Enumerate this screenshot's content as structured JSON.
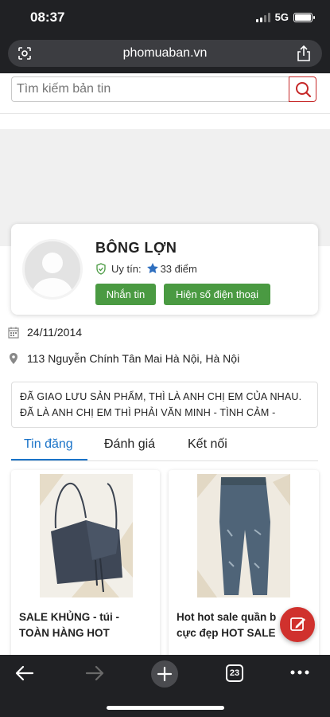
{
  "status": {
    "time": "08:37",
    "network": "5G"
  },
  "browser": {
    "url": "phomuaban.vn",
    "tab_count": "23"
  },
  "search": {
    "placeholder": "Tìm kiếm bản tin"
  },
  "profile": {
    "name": "BÔNG LỢN",
    "trust_label": "Uy tín:",
    "trust_points": "33 điểm",
    "message_button": "Nhắn tin",
    "phone_button": "Hiện số điện thoại",
    "join_date": "24/11/2014",
    "address": "113 Nguyễn Chính Tân Mai Hà Nội, Hà Nội",
    "description": "ĐÃ GIAO LƯU SẢN PHẨM, THÌ LÀ ANH CHỊ EM CỦA NHAU. ĐÃ LÀ ANH CHỊ EM THÌ PHẢI VĂN MINH - TÌNH CẢM -"
  },
  "tabs": [
    {
      "label": "Tin đăng",
      "active": true
    },
    {
      "label": "Đánh giá",
      "active": false
    },
    {
      "label": "Kết nối",
      "active": false
    }
  ],
  "products": [
    {
      "title": "SALE KHỦNG - túi -\nTOÀN HÀNG HOT"
    },
    {
      "title": "Hot hot sale quần b\ncực đẹp HOT SALE"
    }
  ],
  "colors": {
    "accent": "#1a73c8",
    "button_green": "#4a9a42",
    "fab_red": "#d0312d",
    "search_border": "#c62828"
  }
}
